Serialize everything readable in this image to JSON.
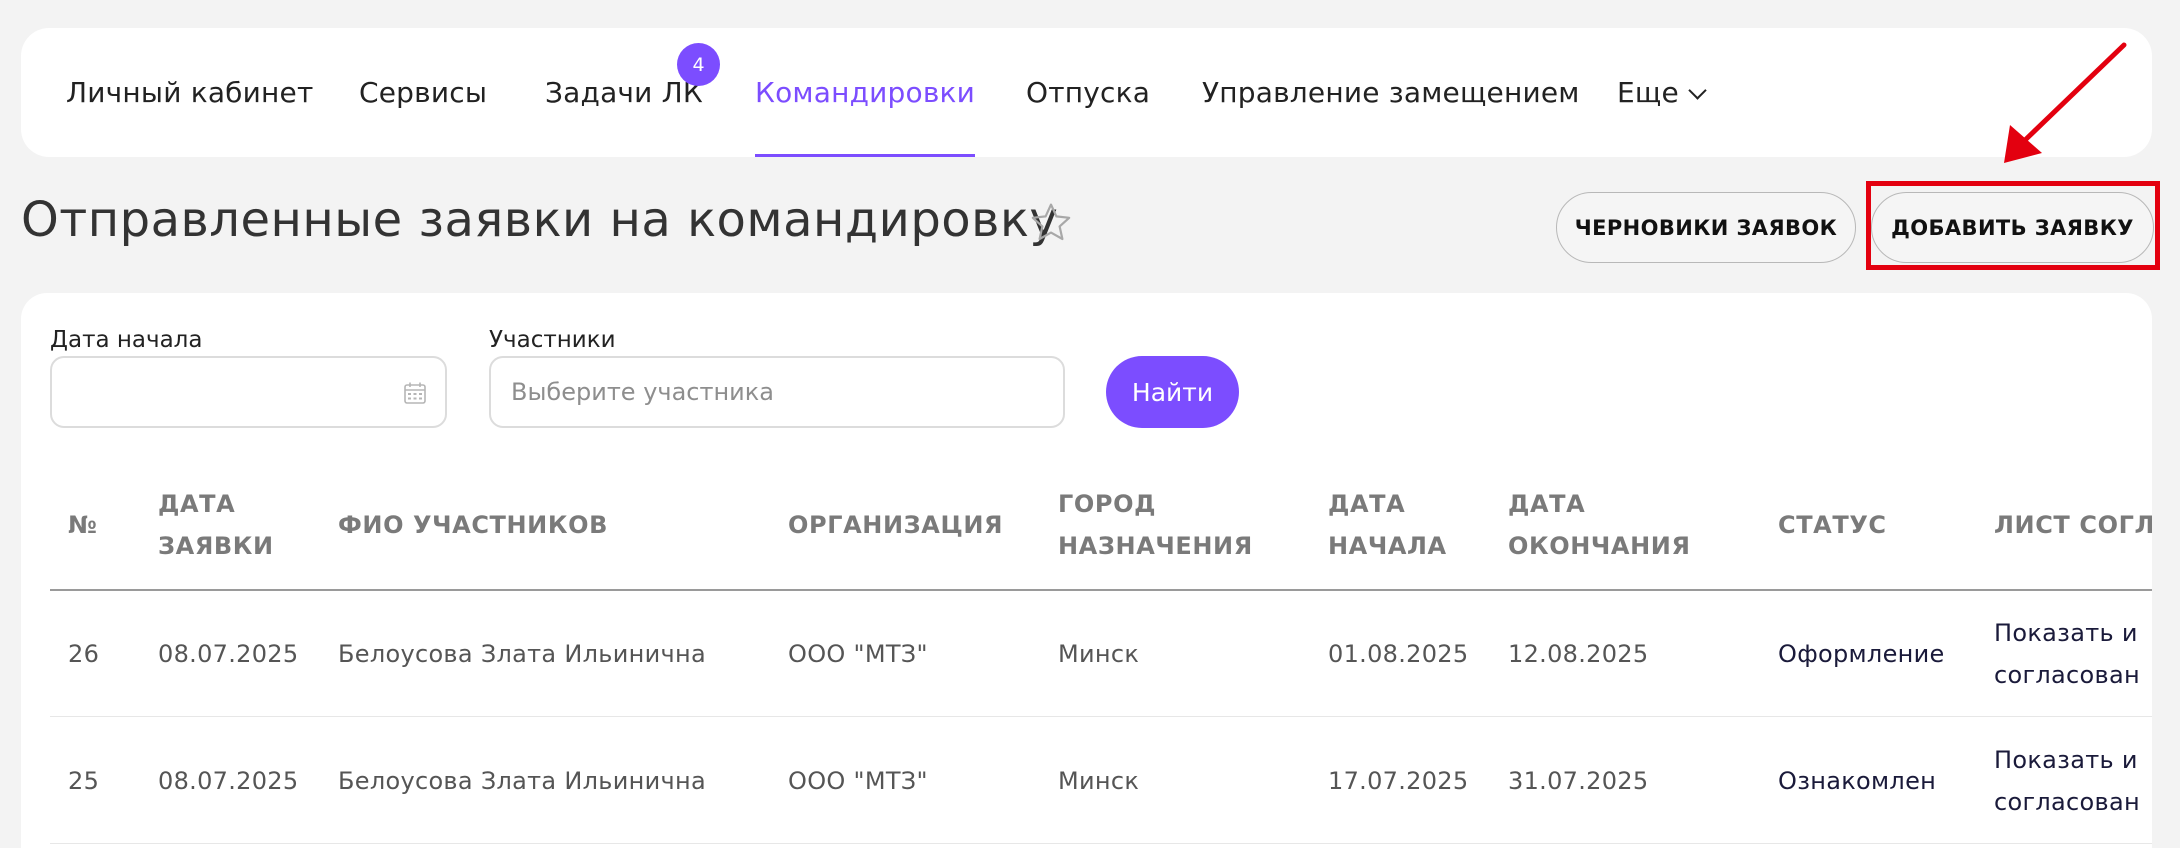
{
  "nav": {
    "items": [
      {
        "label": "Личный кабинет"
      },
      {
        "label": "Сервисы"
      },
      {
        "label": "Задачи ЛК"
      },
      {
        "label": "Командировки"
      },
      {
        "label": "Отпуска"
      },
      {
        "label": "Управление замещением"
      },
      {
        "label": "Еще"
      }
    ],
    "badge": "4",
    "active": "Командировки"
  },
  "page": {
    "title": "Отправленные заявки на командировку",
    "drafts_button": "ЧЕРНОВИКИ ЗАЯВОК",
    "add_button": "ДОБАВИТЬ ЗАЯВКУ"
  },
  "filters": {
    "start_date_label": "Дата начала",
    "start_date_value": "",
    "participants_label": "Участники",
    "participants_placeholder": "Выберите участника",
    "search_button": "Найти"
  },
  "table": {
    "columns": [
      {
        "line1": "№",
        "line2": ""
      },
      {
        "line1": "ДАТА",
        "line2": "ЗАЯВКИ"
      },
      {
        "line1": "ФИО УЧАСТНИКОВ",
        "line2": ""
      },
      {
        "line1": "ОРГАНИЗАЦИЯ",
        "line2": ""
      },
      {
        "line1": "ГОРОД",
        "line2": "НАЗНАЧЕНИЯ"
      },
      {
        "line1": "ДАТА",
        "line2": "НАЧАЛА"
      },
      {
        "line1": "ДАТА",
        "line2": "ОКОНЧАНИЯ"
      },
      {
        "line1": "СТАТУС",
        "line2": ""
      },
      {
        "line1": "ЛИСТ СОГЛ",
        "line2": ""
      }
    ],
    "rows": [
      {
        "num": "26",
        "request_date": "08.07.2025",
        "participants": "Белоусова Злата Ильинична",
        "organization": "ООО \"МТЗ\"",
        "city": "Минск",
        "start": "01.08.2025",
        "end": "12.08.2025",
        "status": "Оформление",
        "sheet_line1": "Показать и",
        "sheet_line2": "согласован"
      },
      {
        "num": "25",
        "request_date": "08.07.2025",
        "participants": "Белоусова Злата Ильинична",
        "organization": "ООО \"МТЗ\"",
        "city": "Минск",
        "start": "17.07.2025",
        "end": "31.07.2025",
        "status": "Ознакомлен",
        "sheet_line1": "Показать и",
        "sheet_line2": "согласован"
      }
    ]
  },
  "colors": {
    "accent": "#7c4dff",
    "annotation": "#e3000f",
    "background": "#f3f3f3"
  },
  "icons": {
    "favorite": "star-outline-icon",
    "date_picker": "calendar-icon",
    "more": "chevron-down-icon",
    "annotation_arrow": "red-arrow-annotation"
  }
}
